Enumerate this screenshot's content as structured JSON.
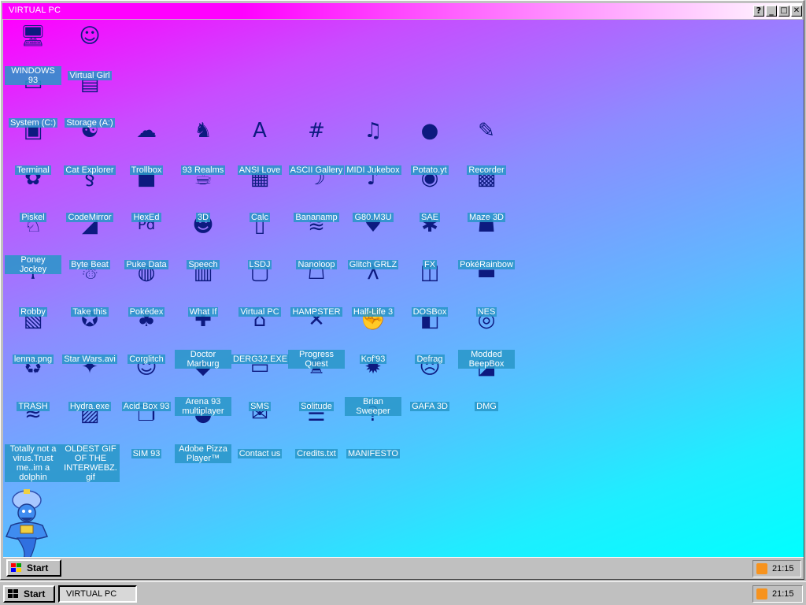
{
  "window": {
    "title": "VIRTUAL PC",
    "help_label": "?",
    "minimize_label": "_",
    "maximize_label": "□",
    "close_label": "✕"
  },
  "desktop": {
    "icons": [
      {
        "label": "WINDOWS 93",
        "icon": "computer-icon"
      },
      {
        "label": "Virtual Girl",
        "icon": "face-icon"
      },
      {
        "label": "System (C:)",
        "icon": "drive-icon"
      },
      {
        "label": "Storage (A:)",
        "icon": "floppy-drive-icon"
      },
      {
        "label": "Terminal",
        "icon": "terminal-icon"
      },
      {
        "label": "Cat Explorer",
        "icon": "cat-globe-icon"
      },
      {
        "label": "Trollbox",
        "icon": "chat-icon"
      },
      {
        "label": "93 Realms",
        "icon": "knight-icon"
      },
      {
        "label": "ANSI Love",
        "icon": "letter-a-icon"
      },
      {
        "label": "ASCII Gallery",
        "icon": "numbers-icon"
      },
      {
        "label": "MIDI Jukebox",
        "icon": "piano-icon"
      },
      {
        "label": "Potato.yt",
        "icon": "potato-icon"
      },
      {
        "label": "Recorder",
        "icon": "microphone-icon"
      },
      {
        "label": "Piskel",
        "icon": "palette-icon"
      },
      {
        "label": "CodeMirror",
        "icon": "snake-icon"
      },
      {
        "label": "HexEd",
        "icon": "cube-icon"
      },
      {
        "label": "3D",
        "icon": "teapot-icon"
      },
      {
        "label": "Calc",
        "icon": "calculator-icon"
      },
      {
        "label": "Bananamp",
        "icon": "banana-icon"
      },
      {
        "label": "G80.M3U",
        "icon": "speaker-icon"
      },
      {
        "label": "SAE",
        "icon": "ball-icon"
      },
      {
        "label": "Maze 3D",
        "icon": "maze-icon"
      },
      {
        "label": "Poney Jockey",
        "icon": "pony-icon"
      },
      {
        "label": "Byte Beat",
        "icon": "beam-icon"
      },
      {
        "label": "Puke Data",
        "icon": "pd-icon"
      },
      {
        "label": "Speech",
        "icon": "speech-face-icon"
      },
      {
        "label": "LSDJ",
        "icon": "gameboy-icon"
      },
      {
        "label": "Nanoloop",
        "icon": "wave-icon"
      },
      {
        "label": "Glitch GRLZ",
        "icon": "lips-icon"
      },
      {
        "label": "FX",
        "icon": "atom-icon"
      },
      {
        "label": "PokéRainbow",
        "icon": "poke-crowd-icon"
      },
      {
        "label": "Robby",
        "icon": "stickman-icon"
      },
      {
        "label": "Take this",
        "icon": "monkey-icon"
      },
      {
        "label": "Pokédex",
        "icon": "poke-ball-icon"
      },
      {
        "label": "What If",
        "icon": "window-lines-icon"
      },
      {
        "label": "Virtual PC",
        "icon": "vpc-icon"
      },
      {
        "label": "HAMPSTER",
        "icon": "hamster-icon"
      },
      {
        "label": "Half-Life 3",
        "icon": "lambda-icon"
      },
      {
        "label": "DOSBox",
        "icon": "dosbox-icon"
      },
      {
        "label": "NES",
        "icon": "nes-icon"
      },
      {
        "label": "lenna.png",
        "icon": "image-file-icon"
      },
      {
        "label": "Star Wars.avi",
        "icon": "yoda-icon"
      },
      {
        "label": "Corglitch",
        "icon": "corgi-icon"
      },
      {
        "label": "Doctor Marburg",
        "icon": "doctor-icon"
      },
      {
        "label": "DERG32.EXE",
        "icon": "monitor-face-icon"
      },
      {
        "label": "Progress Quest",
        "icon": "swords-icon"
      },
      {
        "label": "Kof'93",
        "icon": "fighter-icon"
      },
      {
        "label": "Defrag",
        "icon": "defrag-icon"
      },
      {
        "label": "Modded BeepBox",
        "icon": "donut-icon"
      },
      {
        "label": "TRASH",
        "icon": "trash-icon"
      },
      {
        "label": "Hydra.exe",
        "icon": "hydra-icon"
      },
      {
        "label": "Acid Box 93",
        "icon": "smiley-icon"
      },
      {
        "label": "Arena 93 multiplayer",
        "icon": "arena-cube-icon"
      },
      {
        "label": "SMS",
        "icon": "sms-icon"
      },
      {
        "label": "Solitude",
        "icon": "bottle-icon"
      },
      {
        "label": "Brian Sweeper",
        "icon": "mine-icon"
      },
      {
        "label": "GAFA 3D",
        "icon": "man-face-icon"
      },
      {
        "label": "DMG",
        "icon": "dmg-icon"
      },
      {
        "label": "Totally not a virus.Trust me..im a dolphin",
        "icon": "dolphin-shortcut-icon"
      },
      {
        "label": "OLDEST GIF OF THE INTERWEBZ.gif",
        "icon": "gif-file-icon"
      },
      {
        "label": "SIM 93",
        "icon": "book-icon"
      },
      {
        "label": "Adobe Pizza Player™",
        "icon": "pizza-icon"
      },
      {
        "label": "Contact us",
        "icon": "contact-icon"
      },
      {
        "label": "Credits.txt",
        "icon": "text-file-icon"
      },
      {
        "label": "MANIFESTO",
        "icon": "question-icon"
      }
    ]
  },
  "inner_taskbar": {
    "start_label": "Start",
    "clock": "21:15"
  },
  "outer_taskbar": {
    "start_label": "Start",
    "task_label": "VIRTUAL PC",
    "clock": "21:15"
  },
  "colors": {
    "icon_ink": "#0d1a80",
    "label_bg": "#2896c8",
    "gradient_start": "#ff00ff",
    "gradient_end": "#00ffff"
  }
}
